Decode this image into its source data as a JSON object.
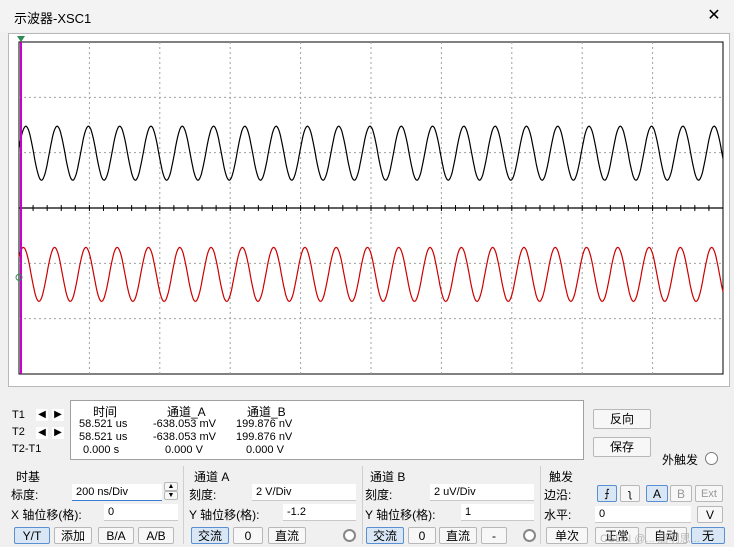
{
  "window": {
    "title": "示波器-XSC1",
    "close_glyph": "✕"
  },
  "colors": {
    "channel_a": "#000000",
    "channel_b": "#cc0000",
    "cursor": "#cc00cc"
  },
  "readout": {
    "headers": [
      "时间",
      "通道_A",
      "通道_B"
    ],
    "rows": [
      {
        "label": "T1",
        "time": "58.521 us",
        "a": "-638.053 mV",
        "b": "199.876 nV"
      },
      {
        "label": "T2",
        "time": "58.521 us",
        "a": "-638.053 mV",
        "b": "199.876 nV"
      },
      {
        "label": "T2-T1",
        "time": "0.000 s",
        "a": "0.000 V",
        "b": "0.000 V"
      }
    ]
  },
  "right_buttons": {
    "reverse": "反向",
    "save": "保存",
    "ext_trigger": "外触发"
  },
  "timebase": {
    "group": "时基",
    "scale_label": "标度:",
    "scale_value": "200 ns/Div",
    "xpos_label": "X 轴位移(格):",
    "xpos_value": "0",
    "modes": [
      "Y/T",
      "添加",
      "B/A",
      "A/B"
    ]
  },
  "channel_a": {
    "group": "通道 A",
    "scale_label": "刻度:",
    "scale_value": "2  V/Div",
    "ypos_label": "Y 轴位移(格):",
    "ypos_value": "-1.2",
    "coupling": [
      "交流",
      "0",
      "直流"
    ]
  },
  "channel_b": {
    "group": "通道 B",
    "scale_label": "刻度:",
    "scale_value": "2 uV/Div",
    "ypos_label": "Y 轴位移(格):",
    "ypos_value": "1",
    "coupling": [
      "交流",
      "0",
      "直流",
      "-"
    ]
  },
  "trigger": {
    "group": "触发",
    "edge_label": "边沿:",
    "level_label": "水平:",
    "level_value": "0",
    "level_unit": "V",
    "sources": [
      "A",
      "B",
      "Ext"
    ],
    "modes": [
      "单次",
      "正常",
      "自动",
      "无"
    ]
  },
  "watermark": "CSDN @... 启明思..."
}
